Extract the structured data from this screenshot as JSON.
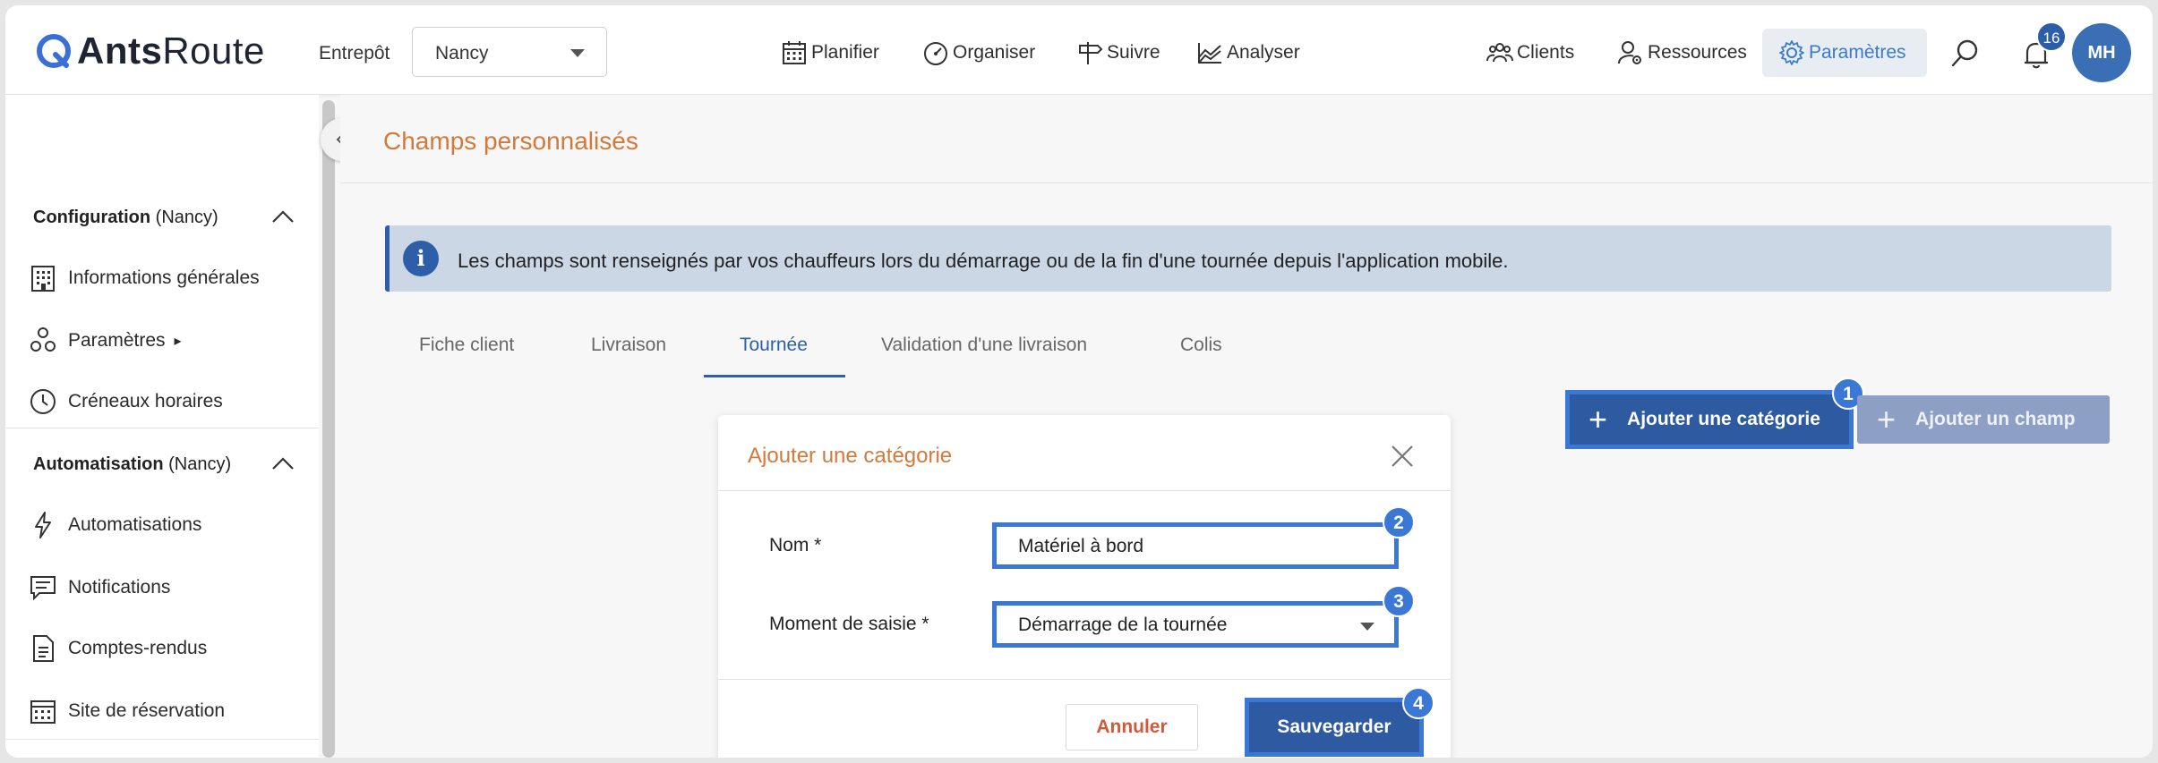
{
  "header": {
    "brand_bold": "Ants",
    "brand_light": "Route",
    "entrepot_label": "Entrepôt",
    "entrepot_value": "Nancy",
    "nav": [
      {
        "label": "Planifier",
        "icon": "calendar-icon"
      },
      {
        "label": "Organiser",
        "icon": "gauge-icon"
      },
      {
        "label": "Suivre",
        "icon": "signpost-icon"
      },
      {
        "label": "Analyser",
        "icon": "chart-icon"
      },
      {
        "label": "Clients",
        "icon": "users-icon"
      },
      {
        "label": "Ressources",
        "icon": "user-gear-icon"
      },
      {
        "label": "Paramètres",
        "icon": "gear-icon"
      }
    ],
    "notification_count": "16",
    "avatar_initials": "MH",
    "accent_color": "#3a7bc8"
  },
  "sidebar": {
    "sections": [
      {
        "title": "Configuration",
        "context": "(Nancy)",
        "items": [
          {
            "label": "Informations générales",
            "icon": "building-icon"
          },
          {
            "label": "Paramètres",
            "icon": "modules-icon",
            "suffix": "▸"
          },
          {
            "label": "Créneaux horaires",
            "icon": "clock-icon"
          }
        ]
      },
      {
        "title": "Automatisation",
        "context": "(Nancy)",
        "items": [
          {
            "label": "Automatisations",
            "icon": "bolt-icon"
          },
          {
            "label": "Notifications",
            "icon": "message-icon"
          },
          {
            "label": "Comptes-rendus",
            "icon": "document-icon"
          },
          {
            "label": "Site de réservation",
            "icon": "calendar-icon"
          }
        ]
      }
    ]
  },
  "main": {
    "page_title": "Champs personnalisés",
    "info_text": "Les champs sont renseignés par vos chauffeurs lors du démarrage ou de la fin d'une tournée depuis l'application mobile.",
    "tabs": [
      {
        "label": "Fiche client",
        "active": false
      },
      {
        "label": "Livraison",
        "active": false
      },
      {
        "label": "Tournée",
        "active": true
      },
      {
        "label": "Validation d'une livraison",
        "active": false
      },
      {
        "label": "Colis",
        "active": false
      }
    ],
    "add_category_label": "Ajouter une catégorie",
    "add_field_label": "Ajouter un champ"
  },
  "modal": {
    "title": "Ajouter une catégorie",
    "name_label": "Nom *",
    "name_value": "Matériel à bord",
    "moment_label": "Moment de saisie *",
    "moment_value": "Démarrage de la tournée",
    "cancel_label": "Annuler",
    "save_label": "Sauvegarder"
  },
  "steps": [
    "1",
    "2",
    "3",
    "4"
  ]
}
